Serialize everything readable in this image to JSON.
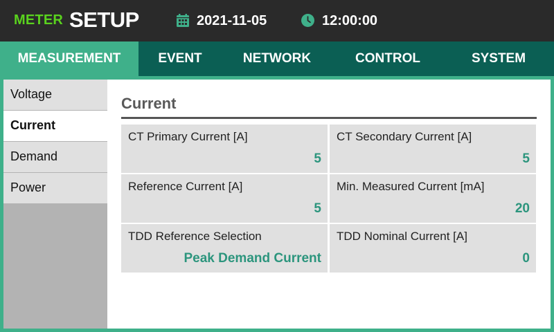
{
  "header": {
    "brand_small": "METER",
    "brand_large": "SETUP",
    "date": "2021-11-05",
    "time": "12:00:00",
    "date_icon": "calendar-icon",
    "time_icon": "clock-icon"
  },
  "tabs": [
    {
      "label": "MEASUREMENT",
      "active": true
    },
    {
      "label": "EVENT",
      "active": false
    },
    {
      "label": "NETWORK",
      "active": false
    },
    {
      "label": "CONTROL",
      "active": false
    },
    {
      "label": "SYSTEM",
      "active": false
    }
  ],
  "sidebar": {
    "items": [
      {
        "label": "Voltage",
        "active": false
      },
      {
        "label": "Current",
        "active": true
      },
      {
        "label": "Demand",
        "active": false
      },
      {
        "label": "Power",
        "active": false
      }
    ]
  },
  "section": {
    "title": "Current",
    "fields": [
      {
        "label": "CT Primary Current [A]",
        "value": "5"
      },
      {
        "label": "CT Secondary Current [A]",
        "value": "5"
      },
      {
        "label": "Reference Current [A]",
        "value": "5"
      },
      {
        "label": "Min. Measured Current [mA]",
        "value": "20"
      },
      {
        "label": "TDD Reference Selection",
        "value": "Peak Demand Current"
      },
      {
        "label": "TDD Nominal Current [A]",
        "value": "0"
      }
    ]
  },
  "colors": {
    "header_bg": "#2a2a2a",
    "brand_green": "#5ad21e",
    "accent": "#3fb08a",
    "tabbar_bg": "#0b5f54",
    "value_text": "#2c957d",
    "field_bg": "#e0e0e0"
  }
}
